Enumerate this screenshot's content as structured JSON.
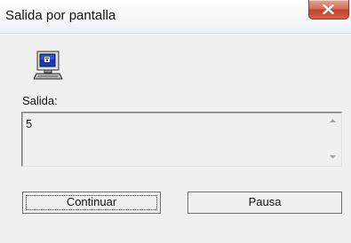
{
  "window": {
    "title": "Salida por pantalla"
  },
  "output": {
    "label": "Salida:",
    "value": "5"
  },
  "buttons": {
    "continue_label": "Continuar",
    "pause_label": "Pausa"
  },
  "icons": {
    "close": "close-icon",
    "app": "computer-icon",
    "scroll_up": "scroll-up-arrow-icon",
    "scroll_down": "scroll-down-arrow-icon"
  },
  "colors": {
    "close_button": "#c8472f",
    "window_background": "#f0f0f0"
  }
}
